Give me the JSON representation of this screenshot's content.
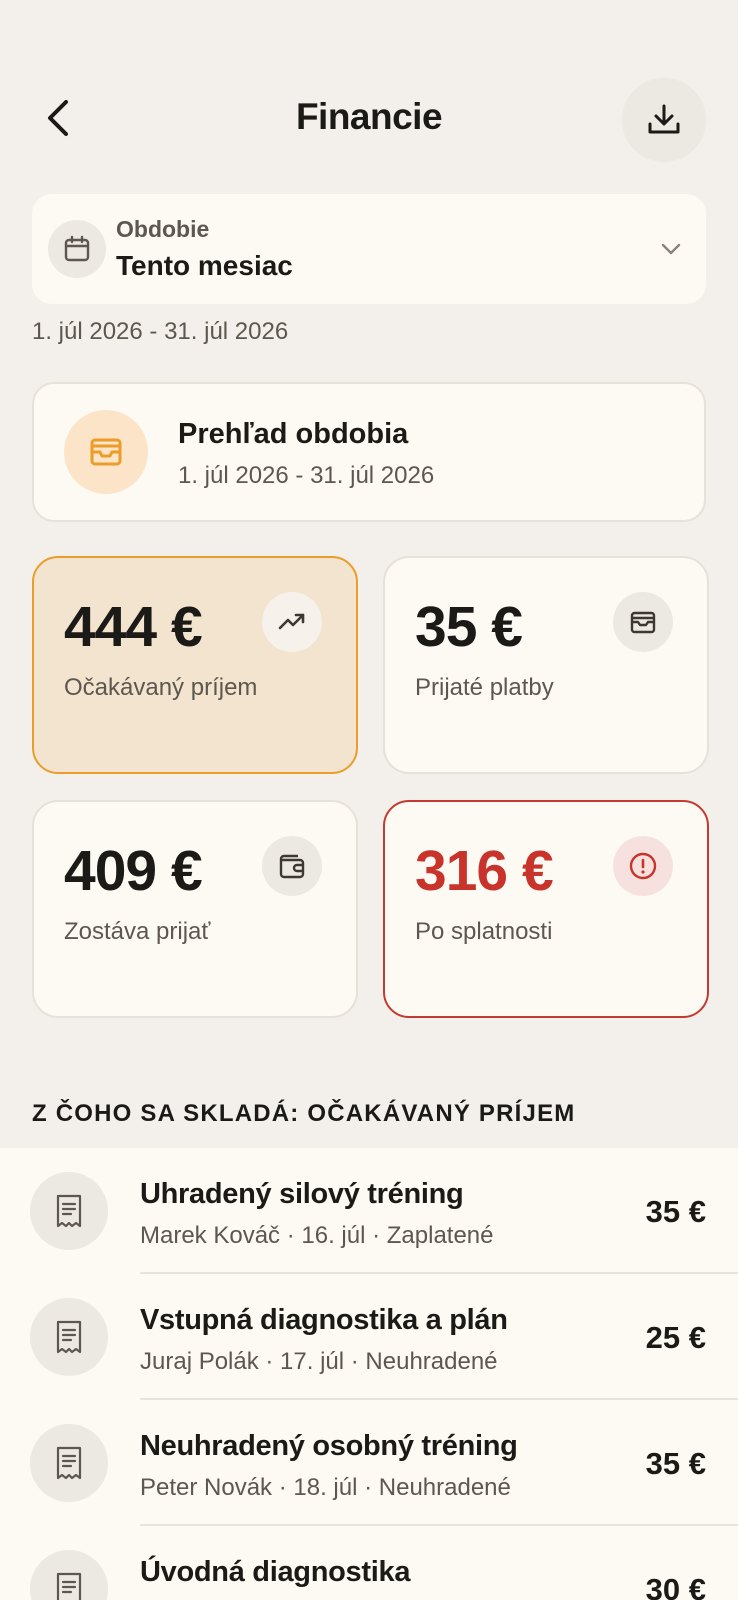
{
  "header": {
    "title": "Financie"
  },
  "period": {
    "label": "Obdobie",
    "value": "Tento mesiac",
    "range": "1. júl 2026 - 31. júl 2026"
  },
  "overview": {
    "title": "Prehľad obdobia",
    "range": "1. júl 2026 - 31. júl 2026"
  },
  "stats": {
    "expected": {
      "value": "444 €",
      "label": "Očakávaný príjem",
      "icon": "trending-up-icon"
    },
    "received": {
      "value": "35 €",
      "label": "Prijaté platby",
      "icon": "inbox-icon"
    },
    "remaining": {
      "value": "409 €",
      "label": "Zostáva prijať",
      "icon": "wallet-icon"
    },
    "overdue": {
      "value": "316 €",
      "label": "Po splatnosti",
      "icon": "alert-circle-icon"
    }
  },
  "section": {
    "title": "Z ČOHO SA SKLADÁ: OČAKÁVANÝ PRÍJEM"
  },
  "items": [
    {
      "title": "Uhradený silový tréning",
      "subtitle": "Marek Kováč · 16. júl · Zaplatené",
      "amount": "35 €"
    },
    {
      "title": "Vstupná diagnostika a plán",
      "subtitle": "Juraj Polák · 17. júl · Neuhradené",
      "amount": "25 €"
    },
    {
      "title": "Neuhradený osobný tréning",
      "subtitle": "Peter Novák · 18. júl · Neuhradené",
      "amount": "35 €"
    },
    {
      "title": "Úvodná diagnostika",
      "subtitle": "",
      "amount": "30 €"
    }
  ],
  "colors": {
    "background": "#f3f0eb",
    "accent": "#eb9d2a",
    "danger": "#c8342b"
  }
}
